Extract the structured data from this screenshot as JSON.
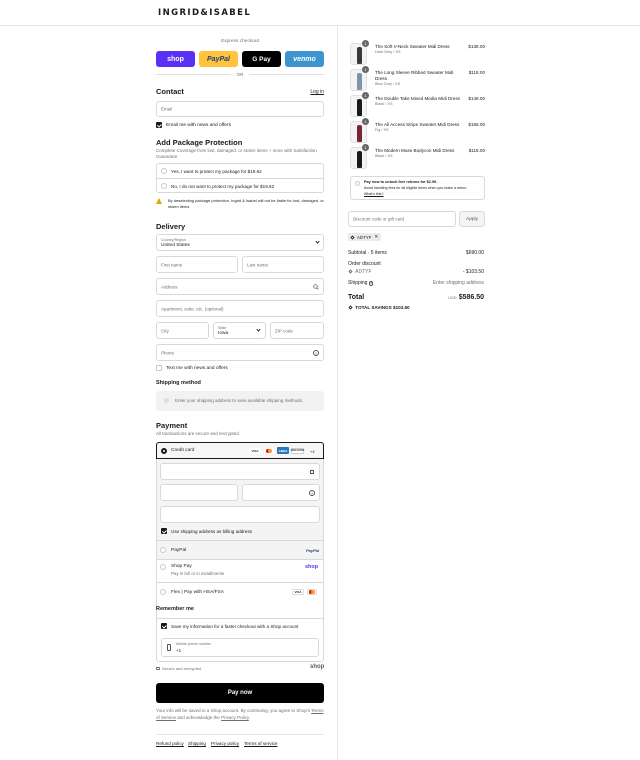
{
  "brand": {
    "logo": "INGRID&ISABEL"
  },
  "express": {
    "label": "Express checkout",
    "shop": "shop",
    "paypal": "PayPal",
    "gpay": "G Pay",
    "venmo": "venmo",
    "or": "OR"
  },
  "contact": {
    "title": "Contact",
    "login": "Log in",
    "email_placeholder": "Email",
    "news": "Email me with news and offers"
  },
  "protection": {
    "title": "Add Package Protection",
    "desc": "Complete Coverage from lost, damaged, or stolen items + more with Satisfaction Guarantee",
    "yes": "Yes, I want to protect my package for $19.62",
    "no": "No, I do not want to protect my package for $19.62",
    "warning": "By deselecting package protection, Ingrid & Isabel will not be liable for lost, damaged, or stolen items"
  },
  "delivery": {
    "title": "Delivery",
    "country_label": "Country/Region",
    "country_value": "United States",
    "first_name": "First name",
    "last_name": "Last name",
    "address": "Address",
    "apartment": "Apartment, suite, etc. (optional)",
    "city": "City",
    "state_label": "State",
    "state_value": "Iowa",
    "zip": "ZIP code",
    "phone": "Phone",
    "text_me": "Text me with news and offers"
  },
  "shipping": {
    "title": "Shipping method",
    "placeholder": "Enter your shipping address to view available shipping methods."
  },
  "payment": {
    "title": "Payment",
    "desc": "All transactions are secure and encrypted.",
    "credit_card": "Credit card",
    "card_brands": [
      "VISA",
      "MC",
      "AMEX",
      "DISCOVER"
    ],
    "more_cards": "+4",
    "billing": "Use shipping address as billing address",
    "paypal": "PayPal",
    "paypal_logo": "PayPal",
    "shoppay": "Shop Pay",
    "shoppay_sub": "Pay in full or in installments",
    "shoppay_logo": "shop",
    "flex": "Flex | Pay with HSA/FSA",
    "flex_cards": [
      "VISA",
      "MC"
    ]
  },
  "remember": {
    "title": "Remember me",
    "save": "Save my information for a faster checkout with a Shop account",
    "mobile_label": "Mobile phone number",
    "mobile_value": "+1",
    "secure": "Secure and encrypted",
    "shop_logo": "shop"
  },
  "pay_now": "Pay now",
  "disclaimer": {
    "text": "Your info will be saved to a Shop account. By continuing, you agree to Shop's",
    "terms": "Terms of Service",
    "and": "and acknowledge the",
    "privacy": "Privacy Policy"
  },
  "footer": {
    "links": [
      "Refund policy",
      "Shipping",
      "Privacy policy",
      "Terms of service"
    ]
  },
  "cart": {
    "items": [
      {
        "name": "The Soft V-Neck Sweater Midi Dress",
        "variant": "Dark Grey / XS",
        "price": "$138.00",
        "qty": "1",
        "color": "#3a3a3a"
      },
      {
        "name": "The Long Sleeve Ribbed Sweater Midi Dress",
        "variant": "Blue Grey / XS",
        "price": "$118.00",
        "qty": "1",
        "color": "#7e93a8"
      },
      {
        "name": "The Double Take Mixed Media Midi Dress",
        "variant": "Black / XS",
        "price": "$148.00",
        "qty": "1",
        "color": "#1a1a1a"
      },
      {
        "name": "The All Access Stripe Sweater Midi Dress",
        "variant": "Fig / XS",
        "price": "$168.00",
        "qty": "1",
        "color": "#7a2630"
      },
      {
        "name": "The Modern Muse Bodycon Midi Dress",
        "variant": "Black / XS",
        "price": "$118.00",
        "qty": "1",
        "color": "#1a1a1a"
      }
    ],
    "returns_title": "Pay now to unlock free returns for $2.99.",
    "returns_text": "Avoid handling fees for all eligible items when you make a return.",
    "returns_link": "What's this?",
    "discount_placeholder": "Discount code or gift card",
    "apply": "Apply",
    "code": "ADTYF",
    "subtotal_label": "Subtotal · 5 items",
    "subtotal_value": "$690.00",
    "order_discount": "Order discount",
    "discount_code": "ADTYF",
    "discount_value": "- $103.50",
    "shipping_label": "Shipping",
    "shipping_value": "Enter shipping address",
    "total_label": "Total",
    "currency": "USD",
    "total_value": "$586.50",
    "savings_label": "TOTAL SAVINGS",
    "savings_value": "$103.50"
  }
}
